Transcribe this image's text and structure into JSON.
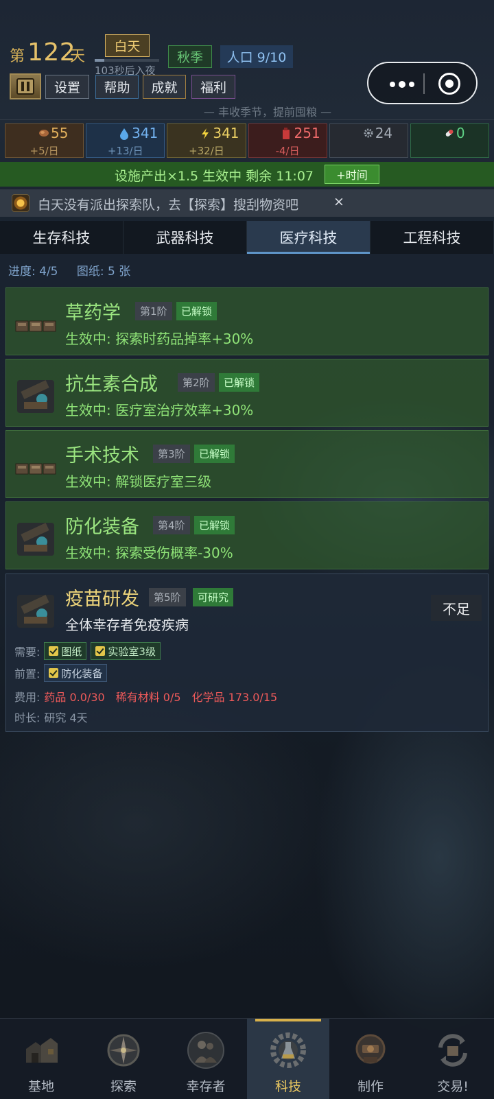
{
  "header": {
    "day_prefix": "第",
    "day_number": "122",
    "day_suffix": "天",
    "time_of_day": "白天",
    "day_progress": 0.15,
    "night_countdown": "103秒后入夜",
    "season": "秋季",
    "population": "人口 9/10",
    "buttons": {
      "settings": "设置",
      "help": "帮助",
      "achievements": "成就",
      "welfare": "福利"
    },
    "festival_notice": "— 丰收季节，提前囤粮 —"
  },
  "resources": [
    {
      "name": "food",
      "icon": "meat-icon",
      "value": "55",
      "rate": "+5/日"
    },
    {
      "name": "water",
      "icon": "water-drop-icon",
      "value": "341",
      "rate": "+13/日"
    },
    {
      "name": "energy",
      "icon": "lightning-icon",
      "value": "341",
      "rate": "+32/日"
    },
    {
      "name": "fuel",
      "icon": "fuel-can-icon",
      "value": "251",
      "rate": "-4/日"
    },
    {
      "name": "parts",
      "icon": "gear-icon",
      "value": "24",
      "rate": ""
    },
    {
      "name": "medicine",
      "icon": "pill-icon",
      "value": "0",
      "rate": ""
    }
  ],
  "boost": {
    "text": "设施产出×1.5 生效中  剩余 11:07",
    "button": "+时间"
  },
  "notice": {
    "text": "白天没有派出探索队，去【探索】搜刮物资吧",
    "close": "×"
  },
  "tabs": [
    "生存科技",
    "武器科技",
    "医疗科技",
    "工程科技"
  ],
  "active_tab": 2,
  "progress": {
    "label": "进度: 4/5",
    "blueprints": "图纸: 5 张"
  },
  "techs": [
    {
      "name": "草药学",
      "tier": "第1阶",
      "status": "已解锁",
      "effect": "生效中: 探索时药品掉率+30%"
    },
    {
      "name": "抗生素合成",
      "tier": "第2阶",
      "status": "已解锁",
      "effect": "生效中: 医疗室治疗效率+30%"
    },
    {
      "name": "手术技术",
      "tier": "第3阶",
      "status": "已解锁",
      "effect": "生效中: 解锁医疗室三级"
    },
    {
      "name": "防化装备",
      "tier": "第4阶",
      "status": "已解锁",
      "effect": "生效中: 探索受伤概率-30%"
    },
    {
      "name": "疫苗研发",
      "tier": "第5阶",
      "status": "可研究",
      "effect": "全体幸存者免疫疾病",
      "action": "不足",
      "requires_label": "需要:",
      "requires": [
        "图纸",
        "实验室3级"
      ],
      "prereq_label": "前置:",
      "prereq": "防化装备",
      "cost_label": "费用:",
      "costs": [
        "药品 0.0/30",
        "稀有材料 0/5",
        "化学品 173.0/15"
      ],
      "duration_label": "时长:",
      "duration": "研究 4天"
    }
  ],
  "nav": [
    {
      "label": "基地",
      "icon": "base-icon"
    },
    {
      "label": "探索",
      "icon": "compass-icon"
    },
    {
      "label": "幸存者",
      "icon": "survivors-icon"
    },
    {
      "label": "科技",
      "icon": "tech-gear-icon"
    },
    {
      "label": "制作",
      "icon": "crafting-icon"
    },
    {
      "label": "交易!",
      "icon": "trade-icon"
    }
  ],
  "colors": {
    "gold": "#e6c26a",
    "unlocked_green": "#9be580",
    "warning_red": "#ef5a5a",
    "tab_active": "#5f95c8"
  }
}
